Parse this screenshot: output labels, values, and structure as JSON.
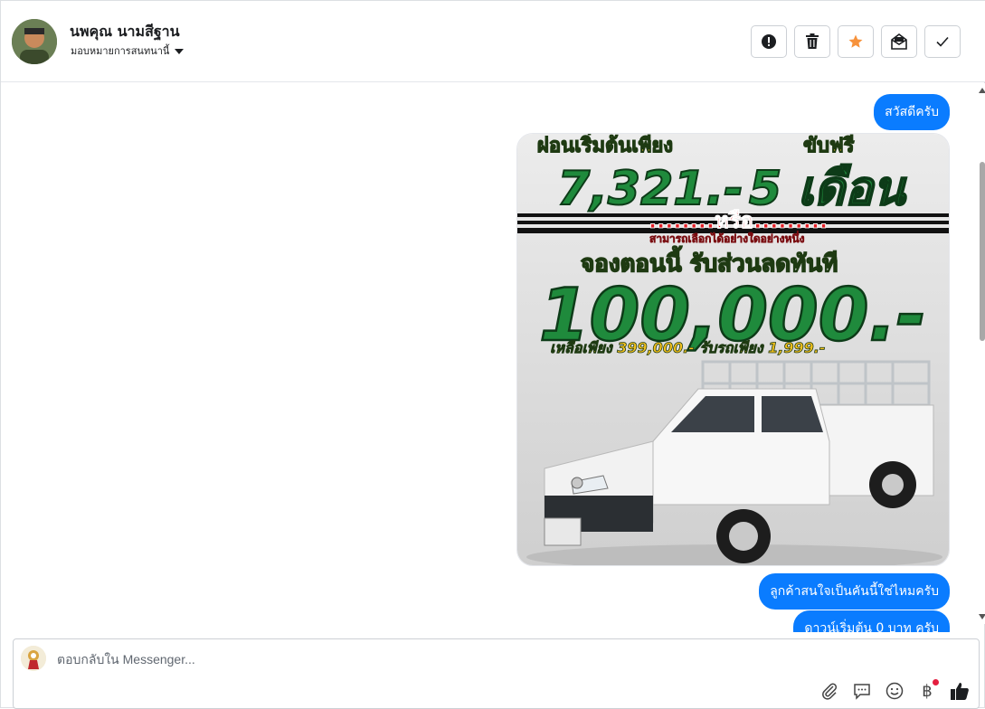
{
  "header": {
    "contact_name": "นพคุณ นามสีฐาน",
    "assign_label": "มอบหมายการสนทนานี้",
    "actions": [
      {
        "name": "spam-button",
        "icon": "exclamation-icon"
      },
      {
        "name": "delete-button",
        "icon": "trash-icon"
      },
      {
        "name": "star-button",
        "icon": "star-icon",
        "color": "#f7923b"
      },
      {
        "name": "mark-unread-button",
        "icon": "envelope-open-icon"
      },
      {
        "name": "mark-done-button",
        "icon": "check-icon"
      }
    ]
  },
  "messages": [
    {
      "type": "text",
      "text": "สวัสดีครับ"
    },
    {
      "type": "image",
      "ad": {
        "line1_left": "ผ่อนเริ่มต้นเพียง",
        "line1_right": "ขับฟรี",
        "price": "7,321.-",
        "months": "5 เดือน",
        "or": "........หรือ.........",
        "choose": "สามารถเลือกได้อย่างใดอย่างหนึ่ง",
        "book": "จองตอนนี้ รับส่วนลดทันที",
        "discount": "100,000.-",
        "remain": "เหลือเพียง 399,000.- รับรถเพียง 1,999.-"
      }
    },
    {
      "type": "text",
      "text": "ลูกค้าสนใจเป็นคันนี้ใช่ไหมครับ"
    },
    {
      "type": "text",
      "text": "ดาวน์เริ่มต้น 0 บาท ครับ"
    }
  ],
  "composer": {
    "placeholder": "ตอบกลับใน Messenger...",
    "tools": [
      "paperclip-icon",
      "saved-reply-icon",
      "emoji-icon",
      "payment-icon",
      "thumbs-up-icon"
    ],
    "baht_symbol": "฿"
  },
  "colors": {
    "bubble": "#0a7cff",
    "star": "#f7923b",
    "ad_green": "#1f8a3c",
    "ad_yellow": "#f4c21e"
  }
}
